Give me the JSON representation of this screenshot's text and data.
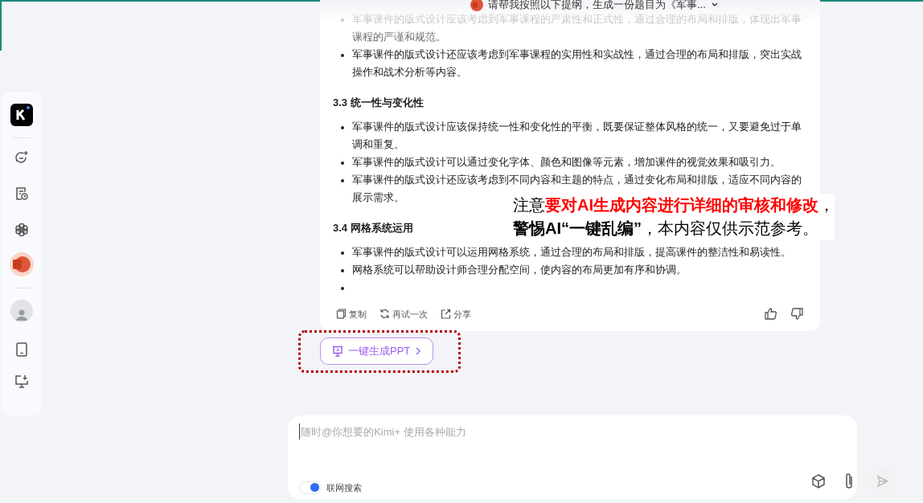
{
  "chat_title": "请帮我按照以下提纲，生成一份题目为《军事...",
  "answer": {
    "sections": [
      {
        "bullets": [
          "军事课件的版式设计应该考虑到军事课程的严肃性和正式性，通过合理的布局和排版，体现出军事课程的严谨和规范。",
          "军事课件的版式设计还应该考虑到军事课程的实用性和实战性，通过合理的布局和排版，突出实战操作和战术分析等内容。"
        ]
      },
      {
        "heading": "3.3 统一性与变化性",
        "bullets": [
          "军事课件的版式设计应该保持统一性和变化性的平衡，既要保证整体风格的统一，又要避免过于单调和重复。",
          "军事课件的版式设计可以通过变化字体、颜色和图像等元素，增加课件的视觉效果和吸引力。",
          "军事课件的版式设计还应该考虑到不同内容和主题的特点，通过变化布局和排版，适应不同内容的展示需求。"
        ]
      },
      {
        "heading": "3.4 网格系统运用",
        "bullets": [
          "军事课件的版式设计可以运用网格系统，通过合理的布局和排版，提高课件的整洁性和易读性。",
          "网格系统可以帮助设计师合理分配空间，使内容的布局更加有序和协调。"
        ],
        "trailing_empty_bullet": true
      }
    ],
    "actions": [
      "复制",
      "再试一次",
      "分享"
    ]
  },
  "ppt_button": "一键生成PPT",
  "annotation": [
    "注意**要对AI生成内容进行详细的审核和修改**，",
    "**警惕AI“一键乱编”**，本内容仅供示范参考。"
  ],
  "input": {
    "placeholder": "随时@你想要的Kimi+ 使用各种能力",
    "web_search": {
      "label": "联网搜索",
      "on": true
    }
  }
}
